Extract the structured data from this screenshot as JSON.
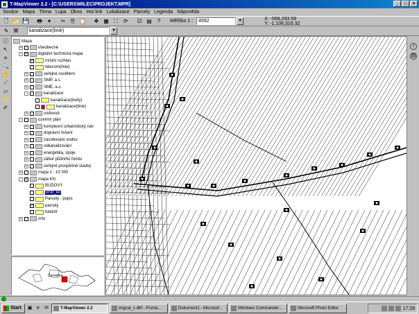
{
  "window": {
    "title": "T-MapViewer 2.2 - [C:\\USERS\\MILEC\\PROJEKT.MPR]",
    "buttons": [
      "_",
      "□",
      "×"
    ]
  },
  "menu": [
    "Soubor",
    "Mapa",
    "Téma",
    "Lupa",
    "Okno",
    "Hot link",
    "Lokalizace",
    "Parcely",
    "Legenda",
    "Nápověda"
  ],
  "toolbar": {
    "scale_label": "Měřítko 1 :",
    "scale_value": "4592",
    "coord_x": "X: -558,293.59",
    "coord_y": "Y: -1,106,316.32",
    "layer_select": "kanalizace(linie)"
  },
  "tree": {
    "root": "Mapa",
    "items": [
      {
        "label": "všeobecné"
      },
      {
        "label": "digitální technická mapa"
      },
      {
        "label": "místní rozhlas"
      },
      {
        "label": "telecom(linie)"
      },
      {
        "label": "veřejné osvětlení"
      },
      {
        "label": "SMP, a.s."
      },
      {
        "label": "SME, a.s."
      },
      {
        "label": "kanalizace"
      },
      {
        "label": "kanalizace(body)"
      },
      {
        "label": "kanalizace(linie)"
      },
      {
        "label": "vodovod"
      },
      {
        "label": "územní plán"
      },
      {
        "label": "komplexní urbanistický náv"
      },
      {
        "label": "dopravní řešení"
      },
      {
        "label": "zásobování vodou"
      },
      {
        "label": "odkanalizování"
      },
      {
        "label": "energetika, spoje"
      },
      {
        "label": "zábor půdního fondu"
      },
      {
        "label": "veřejně prospěšné stavby"
      },
      {
        "label": "mapa 1 : 10 000"
      },
      {
        "label": "mapa KN"
      },
      {
        "label": "BUDOVY"
      },
      {
        "label": "vrstr_kn"
      },
      {
        "label": "Parcely - popis"
      },
      {
        "label": "parcely"
      },
      {
        "label": "katastr"
      },
      {
        "label": "orto"
      }
    ]
  },
  "minimap": {
    "label": "Červeňka"
  },
  "taskbar": {
    "start": "Start",
    "tasks": [
      "T-MapViewer 2.2",
      "imgcat_c.dbf - Pozná...",
      "Dokument1 - Microsof...",
      "Windows Commander...",
      "Microsoft Photo Editor"
    ],
    "clock": "17:28"
  }
}
